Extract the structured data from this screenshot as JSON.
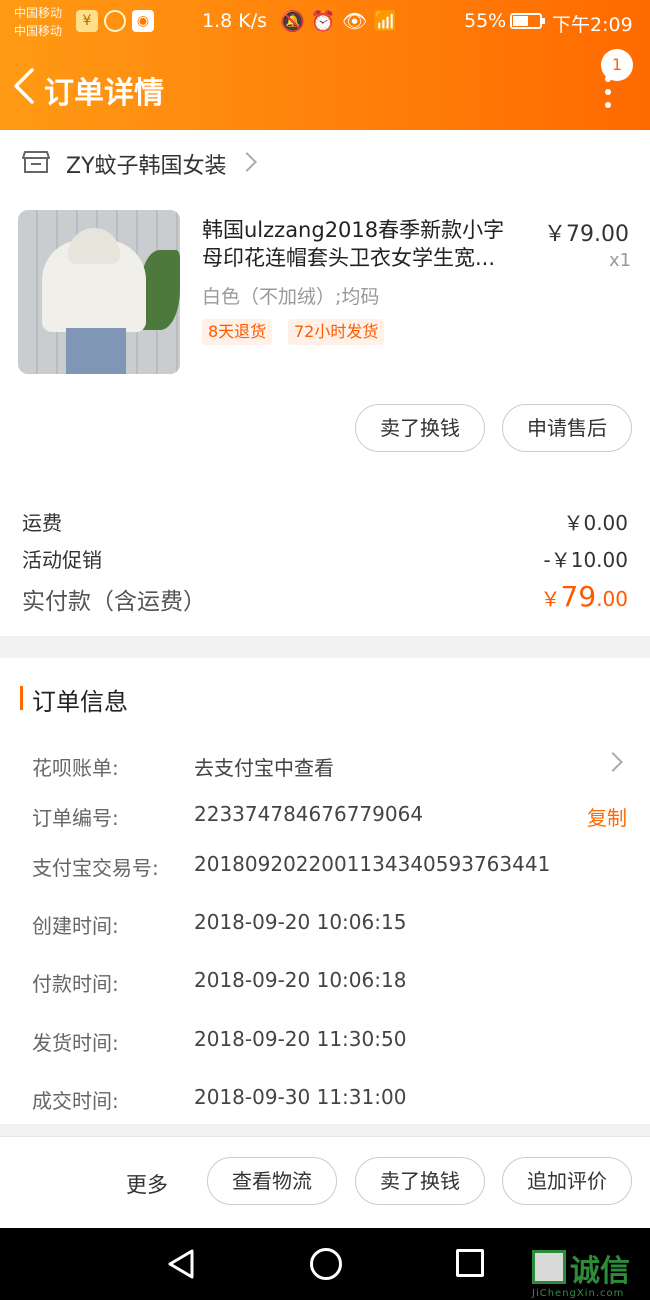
{
  "status_bar": {
    "carrier1": "中国移动",
    "carrier2": "中国移动",
    "speed": "1.8 K/s",
    "battery": "55%",
    "time": "下午2:09"
  },
  "nav": {
    "title": "订单详情",
    "badge": "1"
  },
  "shop": {
    "name": "ZY蚊子韩国女装"
  },
  "product": {
    "title_line1": "韩国ulzzang2018春季新款小字",
    "title_line2": "母印花连帽套头卫衣女学生宽...",
    "price": "￥79.00",
    "qty": "x1",
    "sku": "白色（不加绒）;均码",
    "tags": [
      "8天退货",
      "72小时发货"
    ]
  },
  "product_actions": {
    "sell": "卖了换钱",
    "after_sale": "申请售后"
  },
  "fees": {
    "shipping_label": "运费",
    "shipping_value": "￥0.00",
    "promo_label": "活动促销",
    "promo_value": "-￥10.00",
    "paid_label": "实付款（含运费）",
    "paid_currency": "￥",
    "paid_int": "79",
    "paid_dec": ".00"
  },
  "order_info": {
    "title": "订单信息",
    "rows": [
      {
        "label": "花呗账单:",
        "value": "去支付宝中查看"
      },
      {
        "label": "订单编号:",
        "value": "223374784676779064"
      },
      {
        "label": "支付宝交易号:",
        "value": "2018092022001134340593763441"
      },
      {
        "label": "创建时间:",
        "value": "2018-09-20 10:06:15"
      },
      {
        "label": "付款时间:",
        "value": "2018-09-20 10:06:18"
      },
      {
        "label": "发货时间:",
        "value": "2018-09-20 11:30:50"
      },
      {
        "label": "成交时间:",
        "value": "2018-09-30 11:31:00"
      }
    ],
    "copy_label": "复制"
  },
  "bottom_bar": {
    "more": "更多",
    "logistics": "查看物流",
    "sell": "卖了换钱",
    "review": "追加评价"
  },
  "watermark": {
    "text": "诚信",
    "sub": "JiChengXin.com"
  }
}
